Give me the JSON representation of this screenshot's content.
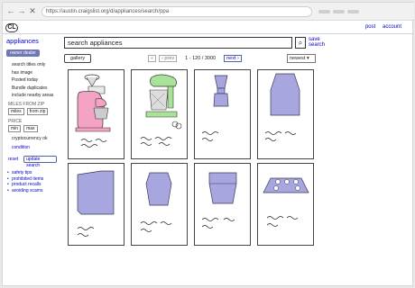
{
  "browser": {
    "url": "https://austin.craigslist.org/d/appliances/search/ppa",
    "nav": {
      "back": "←",
      "forward": "→",
      "reload": "✕"
    }
  },
  "site": {
    "logo": "CL",
    "post_label": "post",
    "account_label": "account"
  },
  "sidebar": {
    "title": "appliances",
    "pill_label": "owner  dealer",
    "checks": [
      "search titles only",
      "has image",
      "Posted today",
      "Bundle duplicates",
      "include nearby areas"
    ],
    "distance_label": "MILES FROM ZIP",
    "miles_label": "miles",
    "zip_label": "from zip",
    "price_label": "PRICE",
    "min_label": "min",
    "max_label": "max",
    "crypto_label": "cryptocurrency ok",
    "condition_label": "condition",
    "reset_label": "reset",
    "update_label": "update search",
    "links": [
      "safety tips",
      "prohibited items",
      "product recalls",
      "avoiding scams"
    ]
  },
  "search": {
    "value": "search appliances",
    "button_glyph": "⌕",
    "save_label": "save\nsearch"
  },
  "controls": {
    "gallery_label": "gallery",
    "first": "«",
    "prev": "‹ prev",
    "range": "1 - 120 / 3000",
    "next": "next ›",
    "sort": "newest ▾"
  },
  "listings": [
    {
      "kind": "stand-mixer-pink"
    },
    {
      "kind": "stand-mixer-green"
    },
    {
      "kind": "small-blender"
    },
    {
      "kind": "large-blender"
    },
    {
      "kind": "box"
    },
    {
      "kind": "vase-shape"
    },
    {
      "kind": "cup-shape"
    },
    {
      "kind": "cooktop"
    }
  ],
  "colors": {
    "link": "#0000cc",
    "item_fill": "#a7a6df",
    "item_stroke": "#3a3a5a",
    "pink_mixer": "#f4a3c4",
    "green_mixer": "#a9e39a"
  }
}
